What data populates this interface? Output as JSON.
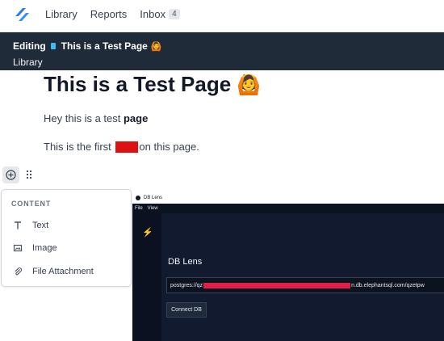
{
  "nav": {
    "links": [
      "Library",
      "Reports"
    ],
    "inbox_label": "Inbox",
    "inbox_count": "4"
  },
  "editing": {
    "label": "Editing",
    "page_title": "This is a Test Page",
    "title_emoji": "🙆",
    "breadcrumb": "Library"
  },
  "content": {
    "title": "This is a Test Page",
    "title_emoji": "🙆",
    "para1_prefix": "Hey this is a test ",
    "para1_bold": "page",
    "para2_prefix": "This is the first ",
    "para2_suffix": "on this page."
  },
  "menu": {
    "section": "CONTENT",
    "items": [
      "Text",
      "Image",
      "File Attachment"
    ]
  },
  "screenshot": {
    "window_title": "DB Lens",
    "menu": [
      "File",
      "View"
    ],
    "heading": "DB Lens",
    "url_prefix": "postgres://qz",
    "url_suffix": "n.db.elephantsql.com/qzetpw",
    "button": "Connect DB"
  },
  "colors": {
    "header_bg": "#1f2b38",
    "accent": "#2a7de1",
    "redaction": "#dd1111"
  },
  "icons": [
    "logo-icon",
    "page-icon",
    "plus-circle-icon",
    "drag-handle-icon",
    "text-icon",
    "image-icon",
    "paperclip-icon",
    "bolt-icon"
  ]
}
